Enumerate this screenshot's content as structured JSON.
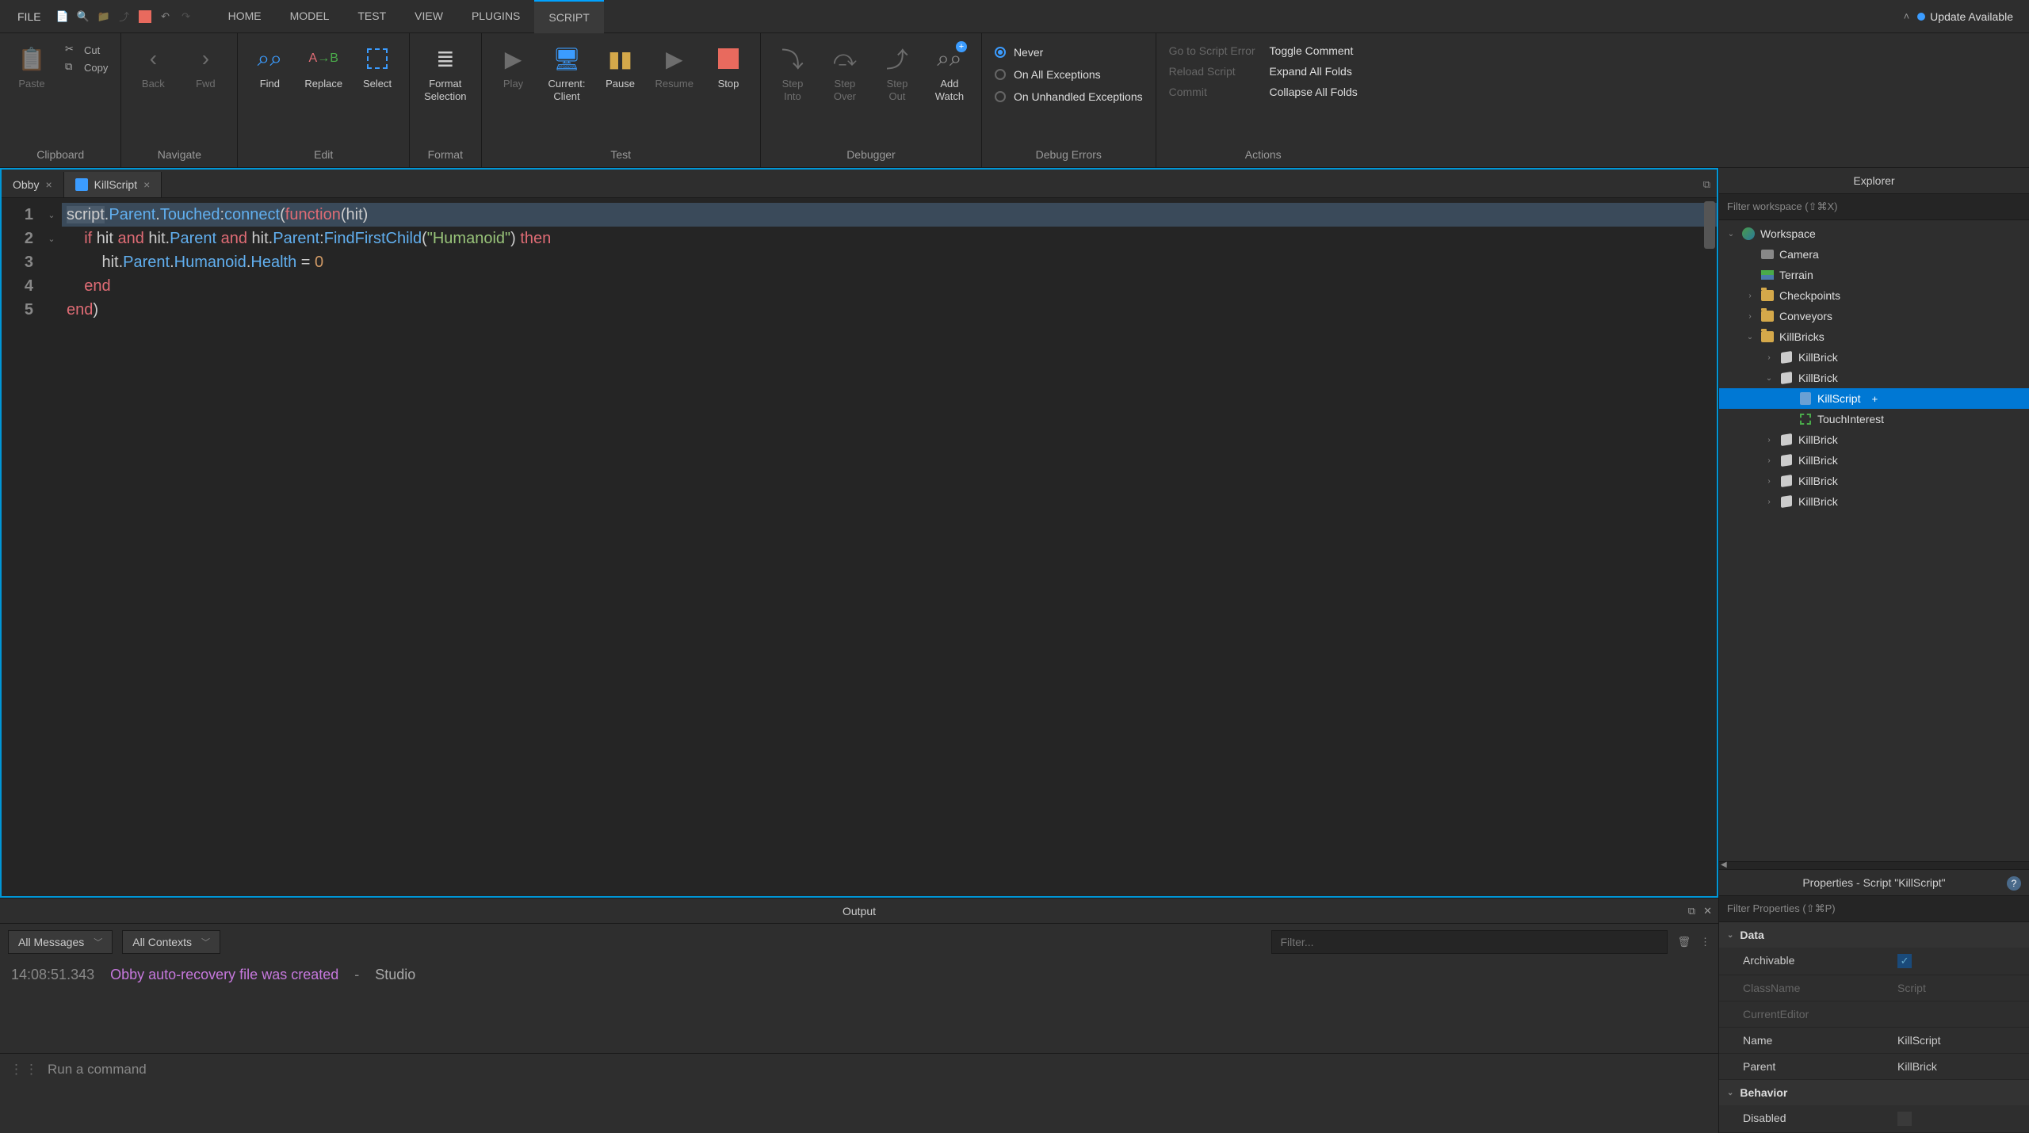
{
  "menubar": {
    "file": "FILE",
    "tabs": [
      "HOME",
      "MODEL",
      "TEST",
      "VIEW",
      "PLUGINS",
      "SCRIPT"
    ],
    "active_tab": 5,
    "update": "Update Available"
  },
  "ribbon": {
    "clipboard": {
      "paste": "Paste",
      "cut": "Cut",
      "copy": "Copy",
      "label": "Clipboard"
    },
    "navigate": {
      "back": "Back",
      "fwd": "Fwd",
      "label": "Navigate"
    },
    "edit": {
      "find": "Find",
      "replace": "Replace",
      "select": "Select",
      "label": "Edit"
    },
    "format": {
      "selection": "Format\nSelection",
      "label": "Format"
    },
    "test": {
      "play": "Play",
      "client": "Current:\nClient",
      "pause": "Pause",
      "resume": "Resume",
      "stop": "Stop",
      "label": "Test"
    },
    "debugger": {
      "into": "Step\nInto",
      "over": "Step\nOver",
      "out": "Step\nOut",
      "watch": "Add\nWatch",
      "label": "Debugger"
    },
    "debug_errors": {
      "never": "Never",
      "all": "On All Exceptions",
      "unhandled": "On Unhandled Exceptions",
      "label": "Debug Errors"
    },
    "actions": {
      "goto": "Go to Script Error",
      "reload": "Reload Script",
      "commit": "Commit",
      "toggle": "Toggle Comment",
      "expand": "Expand All Folds",
      "collapse": "Collapse All Folds",
      "label": "Actions"
    }
  },
  "docs": {
    "tabs": [
      {
        "name": "Obby",
        "icon": "none"
      },
      {
        "name": "KillScript",
        "icon": "script"
      }
    ],
    "active": 1
  },
  "code": {
    "lines": [
      {
        "n": 1,
        "fold": "v",
        "tokens": [
          [
            "sel",
            "script"
          ],
          [
            "op",
            "."
          ],
          [
            "prop",
            "Parent"
          ],
          [
            "op",
            "."
          ],
          [
            "prop",
            "Touched"
          ],
          [
            "op",
            ":"
          ],
          [
            "call",
            "connect"
          ],
          [
            "op",
            "("
          ],
          [
            "fn",
            "function"
          ],
          [
            "op",
            "("
          ],
          [
            "id",
            "hit"
          ],
          [
            "op",
            ")"
          ]
        ]
      },
      {
        "n": 2,
        "fold": "v",
        "indent": 1,
        "tokens": [
          [
            "kw",
            "if"
          ],
          [
            "sp",
            " "
          ],
          [
            "id",
            "hit"
          ],
          [
            "sp",
            " "
          ],
          [
            "kw",
            "and"
          ],
          [
            "sp",
            " "
          ],
          [
            "id",
            "hit"
          ],
          [
            "op",
            "."
          ],
          [
            "prop",
            "Parent"
          ],
          [
            "sp",
            " "
          ],
          [
            "kw",
            "and"
          ],
          [
            "sp",
            " "
          ],
          [
            "id",
            "hit"
          ],
          [
            "op",
            "."
          ],
          [
            "prop",
            "Parent"
          ],
          [
            "op",
            ":"
          ],
          [
            "call",
            "FindFirstChild"
          ],
          [
            "op",
            "("
          ],
          [
            "str",
            "\"Humanoid\""
          ],
          [
            "op",
            ")"
          ],
          [
            "sp",
            " "
          ],
          [
            "kw",
            "then"
          ]
        ]
      },
      {
        "n": 3,
        "indent": 2,
        "tokens": [
          [
            "id",
            "hit"
          ],
          [
            "op",
            "."
          ],
          [
            "prop",
            "Parent"
          ],
          [
            "op",
            "."
          ],
          [
            "prop",
            "Humanoid"
          ],
          [
            "op",
            "."
          ],
          [
            "prop",
            "Health"
          ],
          [
            "sp",
            " "
          ],
          [
            "op",
            "="
          ],
          [
            "sp",
            " "
          ],
          [
            "num",
            "0"
          ]
        ]
      },
      {
        "n": 4,
        "indent": 1,
        "tokens": [
          [
            "kw",
            "end"
          ]
        ]
      },
      {
        "n": 5,
        "tokens": [
          [
            "kw",
            "end"
          ],
          [
            "op",
            ")"
          ]
        ]
      }
    ]
  },
  "output": {
    "title": "Output",
    "messages_dd": "All Messages",
    "contexts_dd": "All Contexts",
    "filter_placeholder": "Filter...",
    "log": {
      "ts": "14:08:51.343",
      "msg": "Obby auto-recovery file was created",
      "dash": "-",
      "src": "Studio"
    },
    "cmd_placeholder": "Run a command"
  },
  "explorer": {
    "title": "Explorer",
    "filter": "Filter workspace (⇧⌘X)",
    "tree": [
      {
        "d": 0,
        "exp": "v",
        "icon": "globe",
        "name": "Workspace"
      },
      {
        "d": 1,
        "exp": "",
        "icon": "camera",
        "name": "Camera"
      },
      {
        "d": 1,
        "exp": "",
        "icon": "terrain",
        "name": "Terrain"
      },
      {
        "d": 1,
        "exp": ">",
        "icon": "folder",
        "name": "Checkpoints"
      },
      {
        "d": 1,
        "exp": ">",
        "icon": "folder",
        "name": "Conveyors"
      },
      {
        "d": 1,
        "exp": "v",
        "icon": "folder",
        "name": "KillBricks"
      },
      {
        "d": 2,
        "exp": ">",
        "icon": "part",
        "name": "KillBrick"
      },
      {
        "d": 2,
        "exp": "v",
        "icon": "part",
        "name": "KillBrick"
      },
      {
        "d": 3,
        "exp": "",
        "icon": "script",
        "name": "KillScript",
        "selected": true,
        "plus": true
      },
      {
        "d": 3,
        "exp": "",
        "icon": "touch",
        "name": "TouchInterest"
      },
      {
        "d": 2,
        "exp": ">",
        "icon": "part",
        "name": "KillBrick"
      },
      {
        "d": 2,
        "exp": ">",
        "icon": "part",
        "name": "KillBrick"
      },
      {
        "d": 2,
        "exp": ">",
        "icon": "part",
        "name": "KillBrick"
      },
      {
        "d": 2,
        "exp": ">",
        "icon": "part",
        "name": "KillBrick"
      }
    ]
  },
  "properties": {
    "title": "Properties - Script \"KillScript\"",
    "filter": "Filter Properties (⇧⌘P)",
    "sections": [
      {
        "name": "Data",
        "rows": [
          {
            "name": "Archivable",
            "type": "check",
            "val": true
          },
          {
            "name": "ClassName",
            "val": "Script",
            "disabled": true
          },
          {
            "name": "CurrentEditor",
            "val": "",
            "disabled": true
          },
          {
            "name": "Name",
            "val": "KillScript"
          },
          {
            "name": "Parent",
            "val": "KillBrick"
          }
        ]
      },
      {
        "name": "Behavior",
        "rows": [
          {
            "name": "Disabled",
            "type": "check",
            "val": false
          }
        ]
      }
    ]
  }
}
